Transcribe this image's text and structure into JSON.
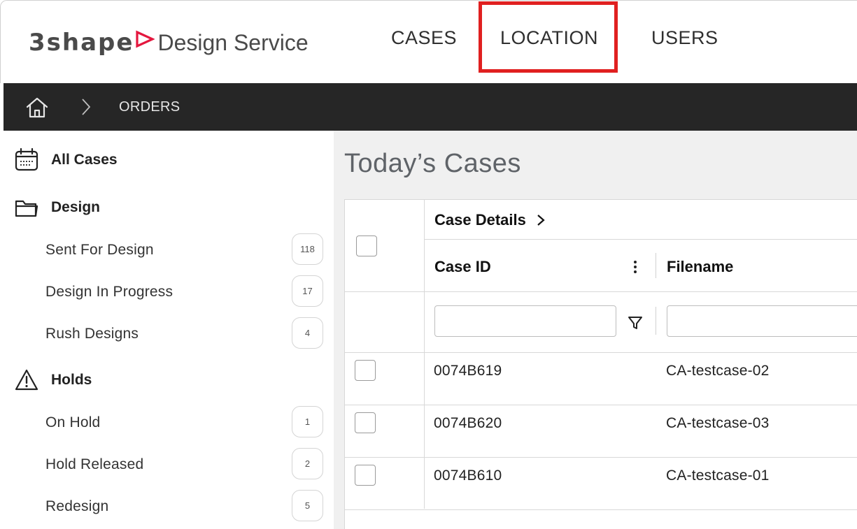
{
  "header": {
    "brand": "3shape",
    "service": "Design Service",
    "nav": [
      {
        "label": "CASES"
      },
      {
        "label": "LOCATION"
      },
      {
        "label": "USERS"
      }
    ],
    "highlight_color": "#e02020"
  },
  "breadcrumb": {
    "current": "ORDERS"
  },
  "sidebar": {
    "groups": [
      {
        "label": "All Cases",
        "icon": "calendar-icon"
      },
      {
        "label": "Design",
        "icon": "folder-icon",
        "items": [
          {
            "label": "Sent For Design",
            "count": "118"
          },
          {
            "label": "Design In Progress",
            "count": "17"
          },
          {
            "label": "Rush Designs",
            "count": "4"
          }
        ]
      },
      {
        "label": "Holds",
        "icon": "warning-icon",
        "items": [
          {
            "label": "On Hold",
            "count": "1"
          },
          {
            "label": "Hold Released",
            "count": "2"
          },
          {
            "label": "Redesign",
            "count": "5"
          }
        ]
      }
    ]
  },
  "main": {
    "title": "Today’s Cases",
    "grid": {
      "group_header": "Case Details",
      "columns": [
        "Case ID",
        "Filename"
      ],
      "filters": {
        "case_id": "",
        "filename": ""
      },
      "rows": [
        {
          "case_id": "0074B619",
          "filename": "CA-testcase-02"
        },
        {
          "case_id": "0074B620",
          "filename": "CA-testcase-03"
        },
        {
          "case_id": "0074B610",
          "filename": "CA-testcase-01"
        }
      ]
    }
  },
  "colors": {
    "brand_red": "#e4173e",
    "crumb_bar": "#262626",
    "main_bg": "#f0f0f0"
  }
}
